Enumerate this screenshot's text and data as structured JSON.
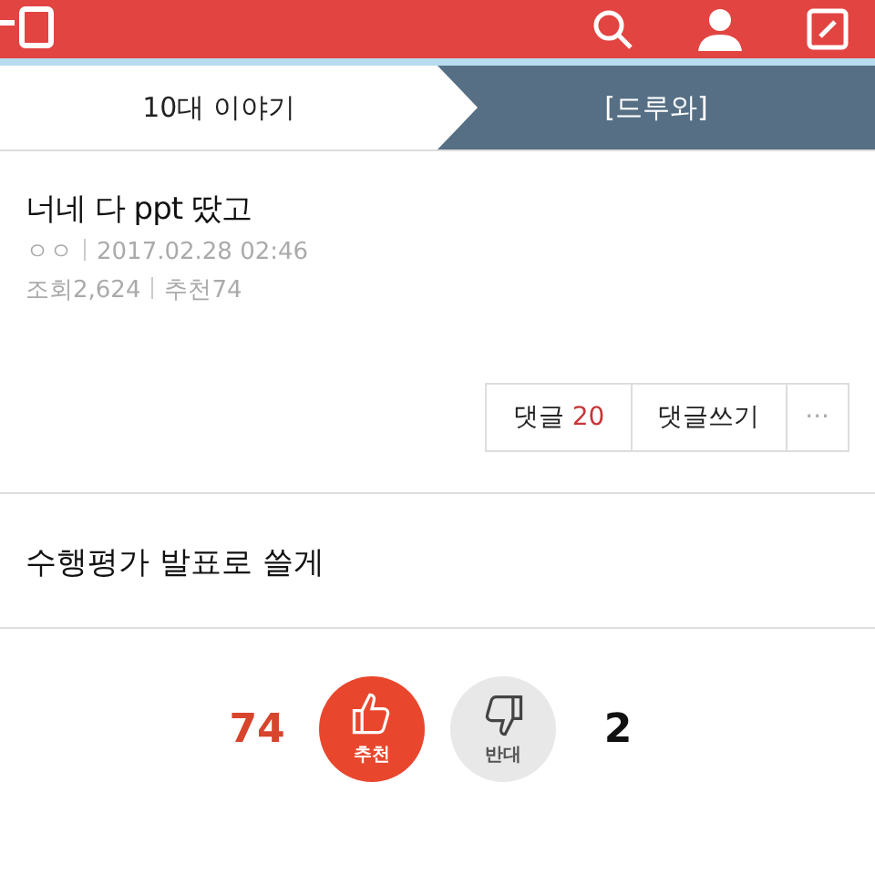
{
  "tabs": [
    {
      "label": "10대 이야기",
      "selected": true
    },
    {
      "label": "[드루와]",
      "selected": false
    }
  ],
  "post": {
    "title": "너네 다 ppt 땄고",
    "author": "ㅇㅇ",
    "date": "2017.02.28 02:46",
    "views": "조회2,624",
    "recommends": "추천74"
  },
  "actions": {
    "comments_label": "댓글",
    "comments_count": "20",
    "write_label": "댓글쓰기",
    "more": "···"
  },
  "body": "수행평가 발표로 쓸게",
  "votes": {
    "up_count": "74",
    "up_label": "추천",
    "down_label": "반대",
    "down_count": "2"
  }
}
